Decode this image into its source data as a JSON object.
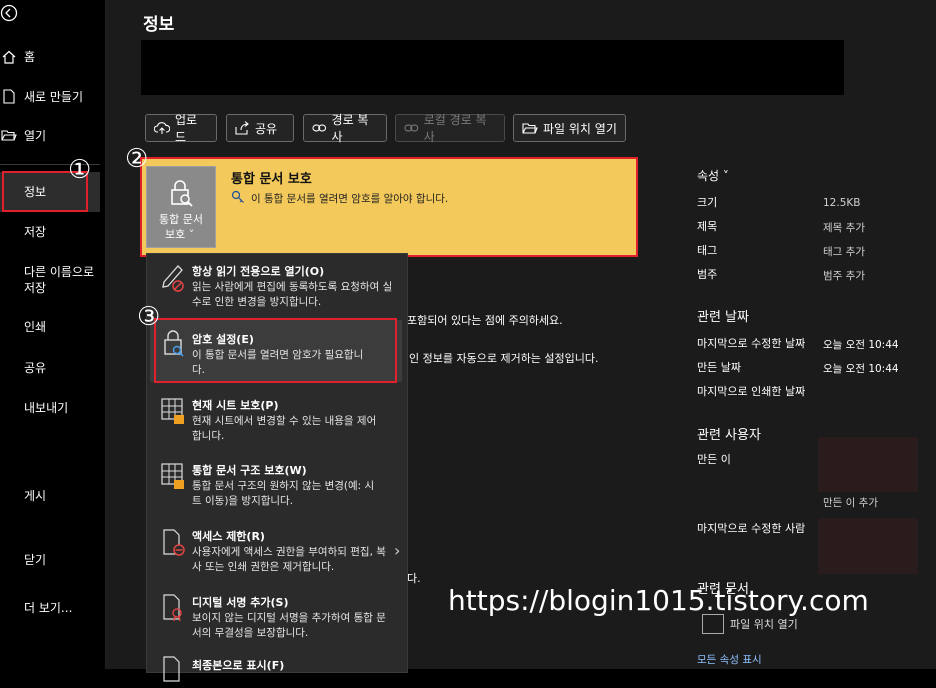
{
  "sidebar": {
    "back_label": "",
    "items": [
      {
        "label": "홈"
      },
      {
        "label": "새로 만들기"
      },
      {
        "label": "열기"
      },
      {
        "label": "정보"
      },
      {
        "label": "저장"
      },
      {
        "label": "다른 이름으로\n저장"
      },
      {
        "label": "인쇄"
      },
      {
        "label": "공유"
      },
      {
        "label": "내보내기"
      },
      {
        "label": "게시"
      },
      {
        "label": "닫기"
      },
      {
        "label": "더 보기..."
      }
    ]
  },
  "page_title": "정보",
  "toolbar": {
    "upload": "업로드",
    "share": "공유",
    "copy_path": "경로 복사",
    "copy_local_path": "로컬 경로 복사",
    "open_location": "파일 위치 열기"
  },
  "protect": {
    "button_label_1": "통합 문서",
    "button_label_2": "보호 ˅",
    "title": "통합 문서 보호",
    "desc": "이 통합 문서를 열려면 암호를 알아야 합니다."
  },
  "menu": {
    "items": [
      {
        "title": "항상 읽기 전용으로 열기(O)",
        "desc": "읽는 사람에게 편집에 동록하도록 요청하여 실수로 인한 변경을 방지합니다."
      },
      {
        "title": "암호 설정(E)",
        "desc": "이 통합 문서를 열려면 암호가 필요합니다."
      },
      {
        "title": "현재 시트 보호(P)",
        "desc": "현재 시트에서 변경할 수 있는 내용을 제어합니다."
      },
      {
        "title": "통합 문서 구조 보호(W)",
        "desc": "통합 문서 구조의 원하지 않는 변경(예: 시트 이동)을 방지합니다."
      },
      {
        "title": "액세스 제한(R)",
        "desc": "사용자에게 액세스 권한을 부여하되 편집, 복사 또는 인쇄 권한은 제거합니다."
      },
      {
        "title": "디지털 서명 추가(S)",
        "desc": "보이지 않는 디지털 서명을 추가하여 통합 문서의 무결성을 보장합니다."
      },
      {
        "title": "최종본으로 표시(F)",
        "desc": ""
      }
    ],
    "submenu_arrow": "›"
  },
  "background_text": {
    "line1": "포함되어 있다는 점에 주의하세요.",
    "line2": "인 정보를 자동으로 제거하는 설정입니다.",
    "line3": "다."
  },
  "properties": {
    "header": "속성 ˅",
    "rows": [
      {
        "label": "크기",
        "value": "12.5KB"
      },
      {
        "label": "제목",
        "value": "제목 추가"
      },
      {
        "label": "태그",
        "value": "태그 추가"
      },
      {
        "label": "범주",
        "value": "범주 추가"
      }
    ],
    "related_dates_title": "관련 날짜",
    "dates": [
      {
        "label": "마지막으로 수정한 날짜",
        "value": "오늘 오전 10:44"
      },
      {
        "label": "만든 날짜",
        "value": "오늘 오전 10:44"
      },
      {
        "label": "마지막으로 인쇄한 날짜",
        "value": ""
      }
    ],
    "related_people_title": "관련 사용자",
    "creator_label": "만든 이",
    "add_author": "만든 이 추가",
    "last_modified_by": "마지막으로 수정한 사람",
    "related_docs_title": "관련 문서",
    "open_file_location": "파일 위치 열기",
    "show_all": "모든 속성 표시"
  },
  "markers": [
    "①",
    "②",
    "③"
  ],
  "watermark": "https://blogin1015.tistory.com",
  "colors": {
    "accent_yellow": "#f2c95a",
    "highlight_red": "#e0202a",
    "menu_bg": "#2b2b2b"
  }
}
